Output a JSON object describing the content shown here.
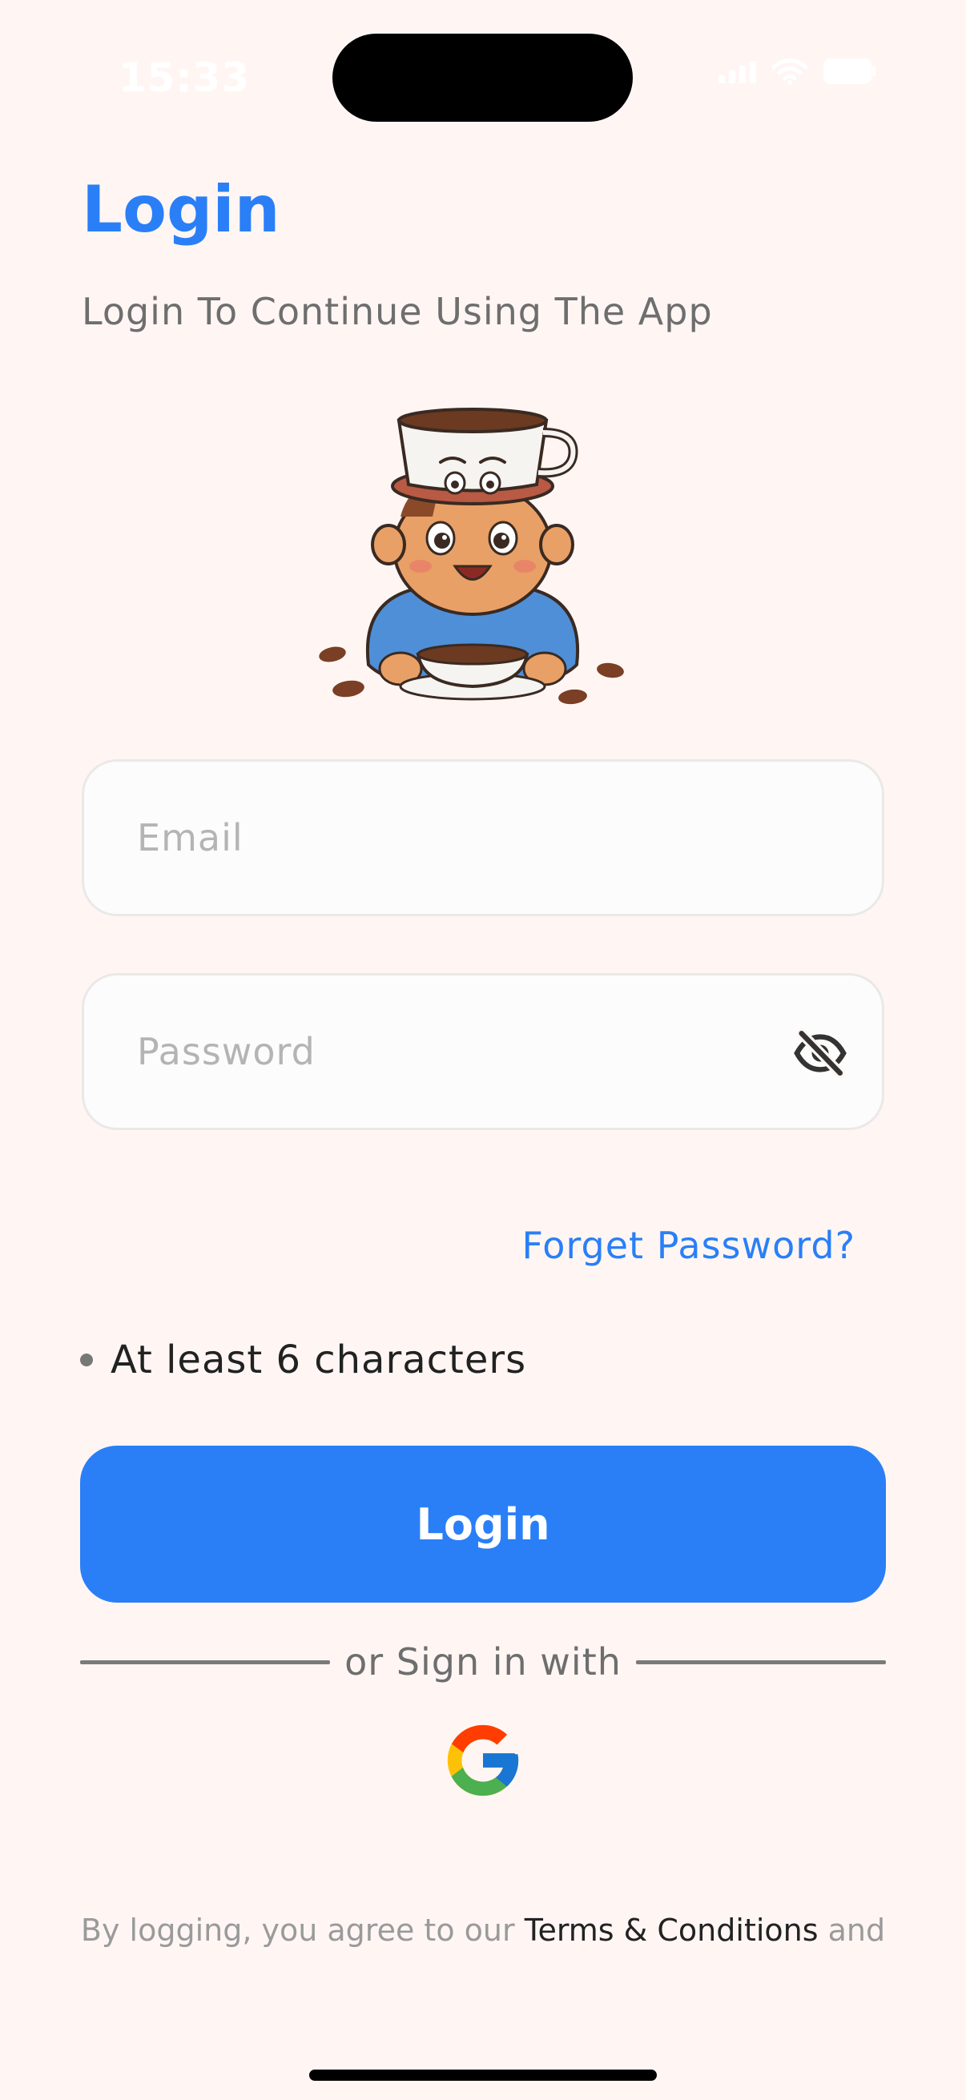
{
  "status_bar": {
    "time": "15:33"
  },
  "header": {
    "title": "Login",
    "subtitle": "Login To Continue Using The App"
  },
  "form": {
    "email_placeholder": "Email",
    "email_value": "",
    "password_placeholder": "Password",
    "password_value": "",
    "forgot_password": "Forget Password?",
    "password_hint": "At least 6 characters",
    "login_button": "Login"
  },
  "social": {
    "divider_text": "or Sign in with",
    "provider": "google-icon"
  },
  "footer": {
    "terms_prefix": "By logging, you agree to our ",
    "terms_link": "Terms & Conditions",
    "terms_suffix": " and"
  },
  "colors": {
    "accent": "#2a7ff7",
    "background": "#fff6f4"
  }
}
